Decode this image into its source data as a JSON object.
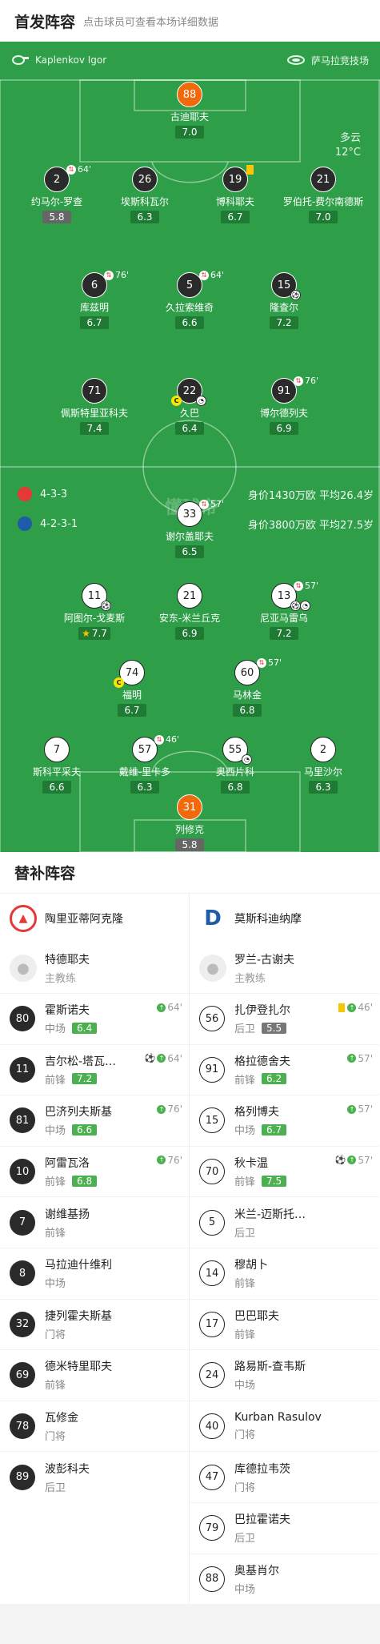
{
  "header": {
    "title": "首发阵容",
    "subtitle": "点击球员可查看本场详细数据"
  },
  "pitch": {
    "referee": "Kaplenkov Igor",
    "venue": "萨马拉竞技场",
    "weather": "多云",
    "temperature": "12°C",
    "watermark": "懂球帝",
    "home_formation": "4-3-3",
    "home_value": "身价1430万欧 平均26.4岁",
    "away_formation": "4-2-3-1",
    "away_value": "身价3800万欧 平均27.5岁"
  },
  "home_players": [
    {
      "number": "88",
      "name": "古迪耶夫",
      "rating": "7.0"
    },
    {
      "number": "2",
      "name": "约马尔-罗查",
      "rating": "5.8",
      "sub": "64'"
    },
    {
      "number": "26",
      "name": "埃斯科瓦尔",
      "rating": "6.3"
    },
    {
      "number": "19",
      "name": "博科耶夫",
      "rating": "6.7"
    },
    {
      "number": "21",
      "name": "罗伯托-费尔南德斯",
      "rating": "7.0"
    },
    {
      "number": "6",
      "name": "库兹明",
      "rating": "6.7",
      "sub": "76'"
    },
    {
      "number": "5",
      "name": "久拉索维奇",
      "rating": "6.6",
      "sub": "64'"
    },
    {
      "number": "15",
      "name": "隆査尔",
      "rating": "7.2"
    },
    {
      "number": "71",
      "name": "佩斯特里亚科夫",
      "rating": "7.4"
    },
    {
      "number": "22",
      "name": "久巴",
      "rating": "6.4"
    },
    {
      "number": "91",
      "name": "博尔德列夫",
      "rating": "6.9",
      "sub": "76'"
    }
  ],
  "away_players": [
    {
      "number": "33",
      "name": "谢尔盖耶夫",
      "rating": "6.5",
      "sub": "57'"
    },
    {
      "number": "11",
      "name": "阿图尔-戈麦斯",
      "rating": "7.7"
    },
    {
      "number": "21",
      "name": "安东-米兰丘克",
      "rating": "6.9"
    },
    {
      "number": "13",
      "name": "尼亚马雷乌",
      "rating": "7.2",
      "sub": "57'"
    },
    {
      "number": "74",
      "name": "福明",
      "rating": "6.7"
    },
    {
      "number": "60",
      "name": "马林金",
      "rating": "6.8",
      "sub": "57'"
    },
    {
      "number": "7",
      "name": "斯科平采夫",
      "rating": "6.6"
    },
    {
      "number": "57",
      "name": "戴维-里卡多",
      "rating": "6.3",
      "sub": "46'"
    },
    {
      "number": "55",
      "name": "奥西片科",
      "rating": "6.8"
    },
    {
      "number": "2",
      "name": "马里沙尔",
      "rating": "6.3"
    },
    {
      "number": "31",
      "name": "列修克",
      "rating": "5.8"
    }
  ],
  "subs": {
    "title": "替补阵容",
    "home_team": "陶里亚蒂阿克隆",
    "away_team": "莫斯科迪纳摩",
    "home_coach": {
      "name": "特德耶夫",
      "role": "主教练"
    },
    "away_coach": {
      "name": "罗兰-古谢夫",
      "role": "主教练"
    },
    "home": [
      {
        "number": "80",
        "name": "霍斯诺夫",
        "pos": "中场",
        "rating": "6.4",
        "event": "64'"
      },
      {
        "number": "11",
        "name": "吉尔松-塔瓦…",
        "pos": "前锋",
        "rating": "7.2",
        "event": "64'"
      },
      {
        "number": "81",
        "name": "巴济列夫斯基",
        "pos": "中场",
        "rating": "6.6",
        "event": "76'"
      },
      {
        "number": "10",
        "name": "阿雷瓦洛",
        "pos": "前锋",
        "rating": "6.8",
        "event": "76'"
      },
      {
        "number": "7",
        "name": "谢维基扬",
        "pos": "前锋"
      },
      {
        "number": "8",
        "name": "马拉迪什维利",
        "pos": "中场"
      },
      {
        "number": "32",
        "name": "捷列霍夫斯基",
        "pos": "门将"
      },
      {
        "number": "69",
        "name": "德米特里耶夫",
        "pos": "前锋"
      },
      {
        "number": "78",
        "name": "瓦修金",
        "pos": "门将"
      },
      {
        "number": "89",
        "name": "波彭科夫",
        "pos": "后卫"
      }
    ],
    "away": [
      {
        "number": "56",
        "name": "扎伊登扎尔",
        "pos": "后卫",
        "rating": "5.5",
        "event": "46'"
      },
      {
        "number": "91",
        "name": "格拉德舍夫",
        "pos": "前锋",
        "rating": "6.2",
        "event": "57'"
      },
      {
        "number": "15",
        "name": "格列博夫",
        "pos": "中场",
        "rating": "6.7",
        "event": "57'"
      },
      {
        "number": "70",
        "name": "秋卡温",
        "pos": "前锋",
        "rating": "7.5",
        "event": "57'"
      },
      {
        "number": "5",
        "name": "米兰-迈斯托…",
        "pos": "后卫"
      },
      {
        "number": "14",
        "name": "穆胡卜",
        "pos": "前锋"
      },
      {
        "number": "17",
        "name": "巴巴耶夫",
        "pos": "前锋"
      },
      {
        "number": "24",
        "name": "路易斯-查韦斯",
        "pos": "中场"
      },
      {
        "number": "40",
        "name": "Kurban Rasulov",
        "pos": "门将"
      },
      {
        "number": "47",
        "name": "库德拉韦茨",
        "pos": "门将"
      },
      {
        "number": "79",
        "name": "巴拉霍诺夫",
        "pos": "后卫"
      },
      {
        "number": "88",
        "name": "奥基肖尔",
        "pos": "中场"
      }
    ]
  },
  "colors": {
    "pitch": "#2e9e48",
    "rating": "#1f7a33",
    "sub_rating": "#4caf50",
    "goalkeeper": "#f06a0c"
  }
}
